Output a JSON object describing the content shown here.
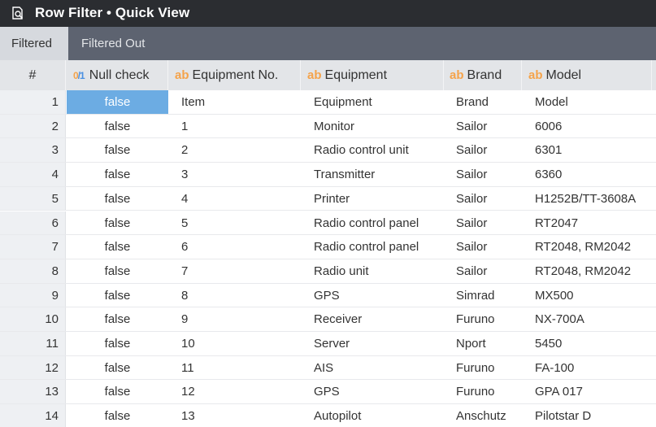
{
  "window": {
    "title": "Row Filter • Quick View",
    "icon": "search-document-icon"
  },
  "tabs": [
    {
      "label": "Filtered",
      "active": true
    },
    {
      "label": "Filtered Out",
      "active": false
    }
  ],
  "table": {
    "columns": {
      "rownum": "#",
      "null_check": {
        "type": "0/1",
        "type_zero": "0",
        "type_slash": "/",
        "type_one": "1",
        "label": "Null check"
      },
      "equipment_no": {
        "type": "ab",
        "label": "Equipment No."
      },
      "equipment": {
        "type": "ab",
        "label": "Equipment"
      },
      "brand": {
        "type": "ab",
        "label": "Brand"
      },
      "model": {
        "type": "ab",
        "label": "Model"
      }
    },
    "rows": [
      {
        "n": "1",
        "null_check": "false",
        "equipment_no": "Item",
        "equipment": "Equipment",
        "brand": "Brand",
        "model": "Model"
      },
      {
        "n": "2",
        "null_check": "false",
        "equipment_no": "1",
        "equipment": "Monitor",
        "brand": "Sailor",
        "model": "6006"
      },
      {
        "n": "3",
        "null_check": "false",
        "equipment_no": "2",
        "equipment": "Radio control unit",
        "brand": "Sailor",
        "model": "6301"
      },
      {
        "n": "4",
        "null_check": "false",
        "equipment_no": "3",
        "equipment": "Transmitter",
        "brand": "Sailor",
        "model": "6360"
      },
      {
        "n": "5",
        "null_check": "false",
        "equipment_no": "4",
        "equipment": "Printer",
        "brand": "Sailor",
        "model": "H1252B/TT-3608A"
      },
      {
        "n": "6",
        "null_check": "false",
        "equipment_no": "5",
        "equipment": "Radio control panel",
        "brand": "Sailor",
        "model": "RT2047"
      },
      {
        "n": "7",
        "null_check": "false",
        "equipment_no": "6",
        "equipment": "Radio control panel",
        "brand": "Sailor",
        "model": "RT2048, RM2042"
      },
      {
        "n": "8",
        "null_check": "false",
        "equipment_no": "7",
        "equipment": "Radio unit",
        "brand": "Sailor",
        "model": "RT2048, RM2042"
      },
      {
        "n": "9",
        "null_check": "false",
        "equipment_no": "8",
        "equipment": "GPS",
        "brand": "Simrad",
        "model": "MX500"
      },
      {
        "n": "10",
        "null_check": "false",
        "equipment_no": "9",
        "equipment": "Receiver",
        "brand": "Furuno",
        "model": "NX-700A"
      },
      {
        "n": "11",
        "null_check": "false",
        "equipment_no": "10",
        "equipment": "Server",
        "brand": "Nport",
        "model": "5450"
      },
      {
        "n": "12",
        "null_check": "false",
        "equipment_no": "11",
        "equipment": "AIS",
        "brand": "Furuno",
        "model": "FA-100"
      },
      {
        "n": "13",
        "null_check": "false",
        "equipment_no": "12",
        "equipment": "GPS",
        "brand": "Furuno",
        "model": "GPA 017"
      },
      {
        "n": "14",
        "null_check": "false",
        "equipment_no": "13",
        "equipment": "Autopilot",
        "brand": "Anschutz",
        "model": "Pilotstar D"
      }
    ]
  },
  "colors": {
    "titlebar": "#2b2d31",
    "tabbar": "#5d6370",
    "active_tab": "#d6d9de",
    "header": "#e3e5e8",
    "selected_cell": "#6cace3",
    "type_badge": "#f5a34a"
  }
}
